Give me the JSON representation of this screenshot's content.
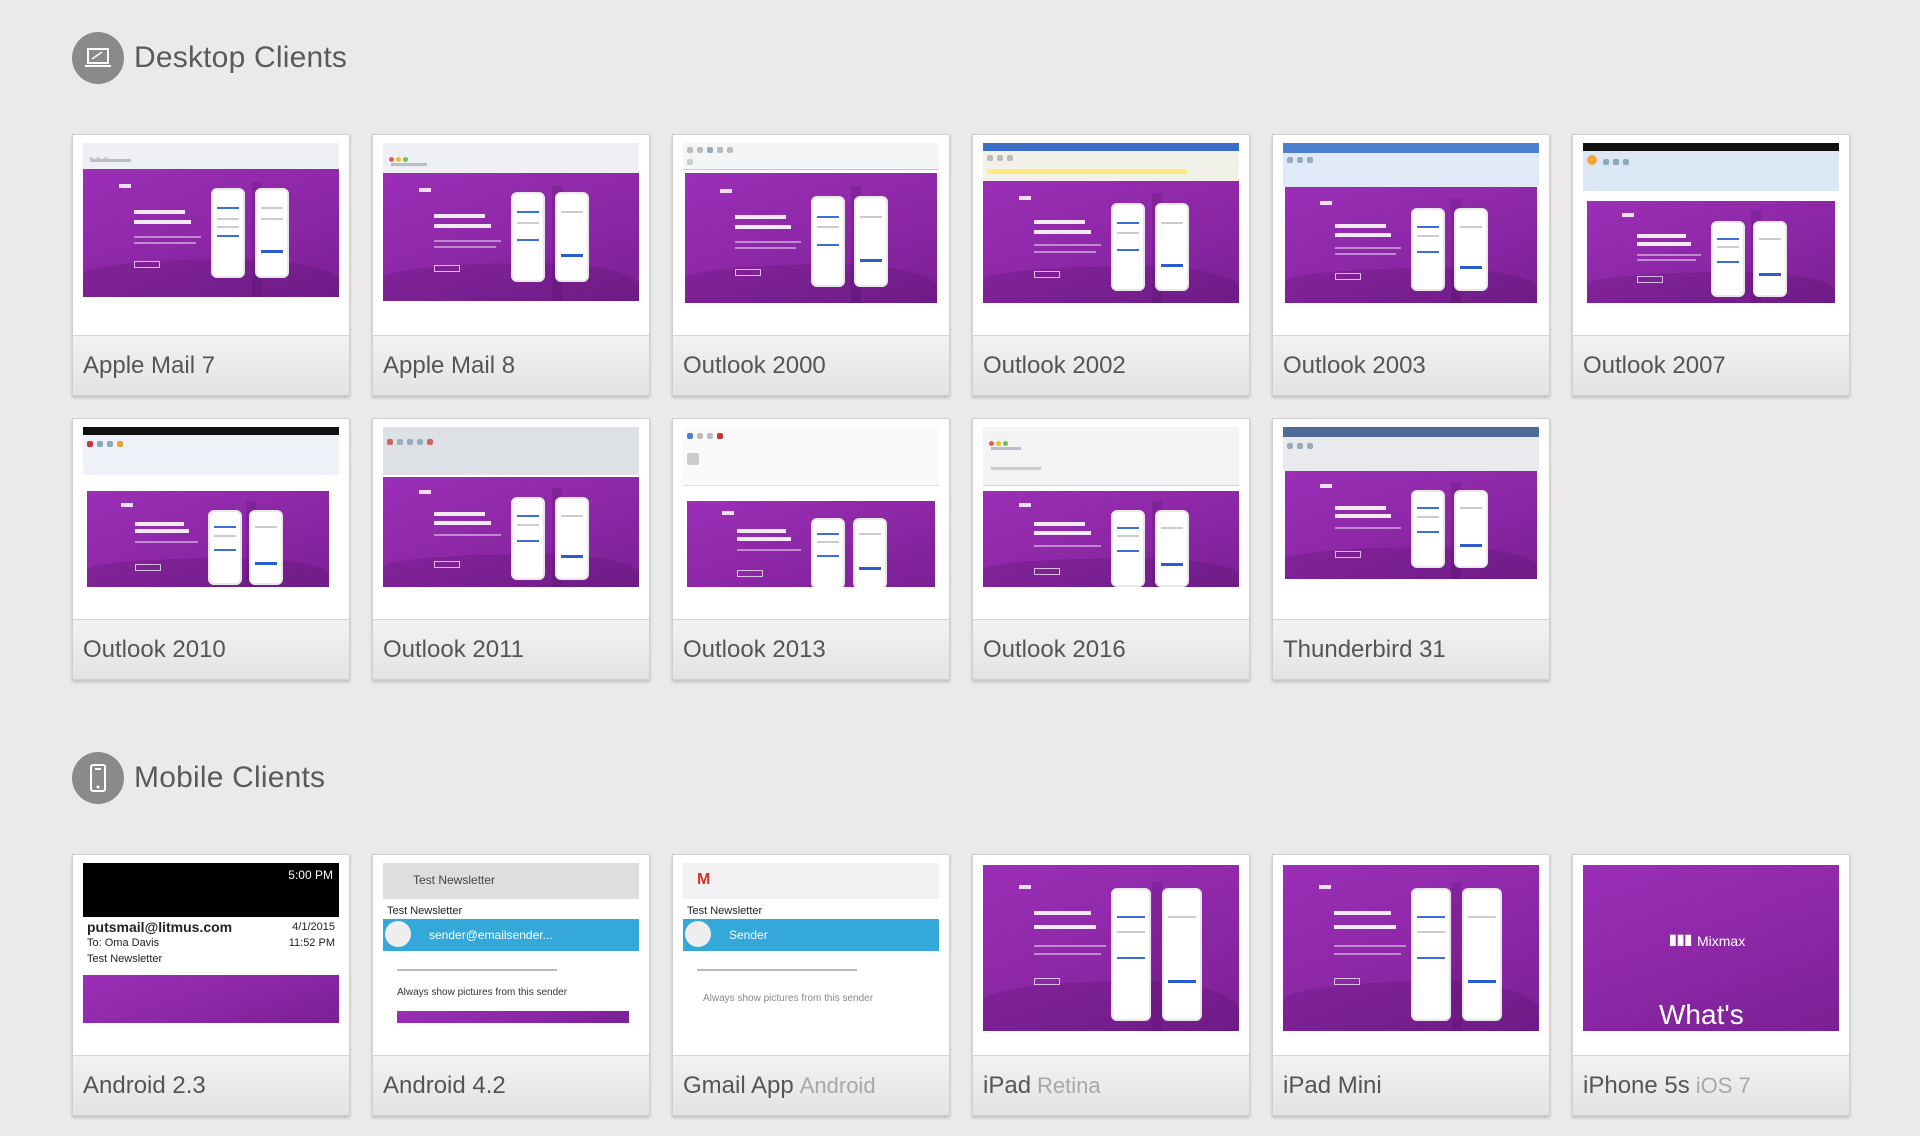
{
  "desktop": {
    "title": "Desktop Clients",
    "icon": "laptop-icon",
    "clients": [
      {
        "name": "Apple Mail 7",
        "sub": ""
      },
      {
        "name": "Apple Mail 8",
        "sub": ""
      },
      {
        "name": "Outlook 2000",
        "sub": ""
      },
      {
        "name": "Outlook 2002",
        "sub": ""
      },
      {
        "name": "Outlook 2003",
        "sub": ""
      },
      {
        "name": "Outlook 2007",
        "sub": ""
      },
      {
        "name": "Outlook 2010",
        "sub": ""
      },
      {
        "name": "Outlook 2011",
        "sub": ""
      },
      {
        "name": "Outlook 2013",
        "sub": ""
      },
      {
        "name": "Outlook 2016",
        "sub": ""
      },
      {
        "name": "Thunderbird 31",
        "sub": ""
      }
    ]
  },
  "mobile": {
    "title": "Mobile Clients",
    "icon": "mobile-phone-icon",
    "clients": [
      {
        "name": "Android 2.3",
        "sub": ""
      },
      {
        "name": "Android 4.2",
        "sub": ""
      },
      {
        "name": "Gmail App",
        "sub": "Android"
      },
      {
        "name": "iPad",
        "sub": "Retina"
      },
      {
        "name": "iPad Mini",
        "sub": ""
      },
      {
        "name": "iPhone 5s",
        "sub": "iOS 7"
      }
    ],
    "android23": {
      "time": "5:00 PM",
      "email": "putsmail@litmus.com",
      "to": "To: Oma Davis",
      "date": "4/1/2015",
      "clock": "11:52 PM",
      "subject": "Test Newsletter"
    },
    "android42": {
      "title": "Test Newsletter",
      "subject": "Test Newsletter",
      "sender": "sender@emailsender...",
      "images_note": "Always show pictures from this sender"
    },
    "gmail": {
      "subject": "Test Newsletter",
      "sender": "Sender",
      "images_note": "Always show pictures from this sender"
    },
    "iphone": {
      "brand": "Mixmax",
      "headline": "What's"
    }
  },
  "colors": {
    "accent_purple": "#8e2aa9",
    "background": "#ebeae8",
    "gmail_blue": "#33a8d9"
  }
}
